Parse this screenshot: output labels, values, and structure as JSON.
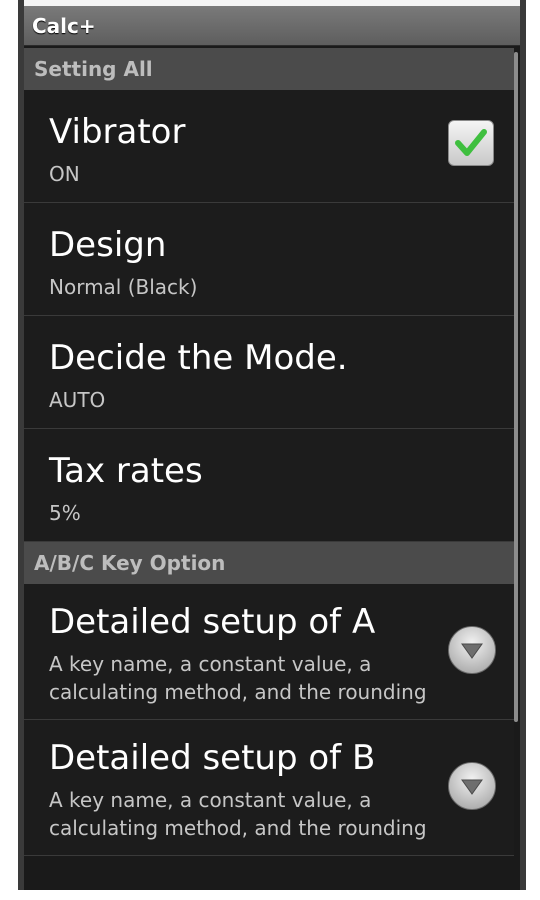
{
  "app": {
    "title": "Calc+"
  },
  "sections": [
    {
      "header": "Setting All",
      "items": [
        {
          "title": "Vibrator",
          "summary": "ON",
          "widget": "checkbox",
          "checked": true
        },
        {
          "title": "Design",
          "summary": "Normal (Black)"
        },
        {
          "title": "Decide the Mode.",
          "summary": "AUTO"
        },
        {
          "title": "Tax rates",
          "summary": "5%"
        }
      ]
    },
    {
      "header": "A/B/C Key Option",
      "items": [
        {
          "title": "Detailed setup of A",
          "summary": "A key name, a constant value, a calculating method, and the rounding",
          "widget": "dropdown"
        },
        {
          "title": "Detailed setup of B",
          "summary": "A key name, a constant value, a calculating method, and the rounding",
          "widget": "dropdown"
        }
      ]
    }
  ],
  "icons": {
    "checkbox": "checkmark-icon",
    "dropdown": "chevron-down-icon"
  },
  "colors": {
    "check": "#3fbf3f",
    "background": "#1c1c1c",
    "header": "#4b4b4b"
  }
}
